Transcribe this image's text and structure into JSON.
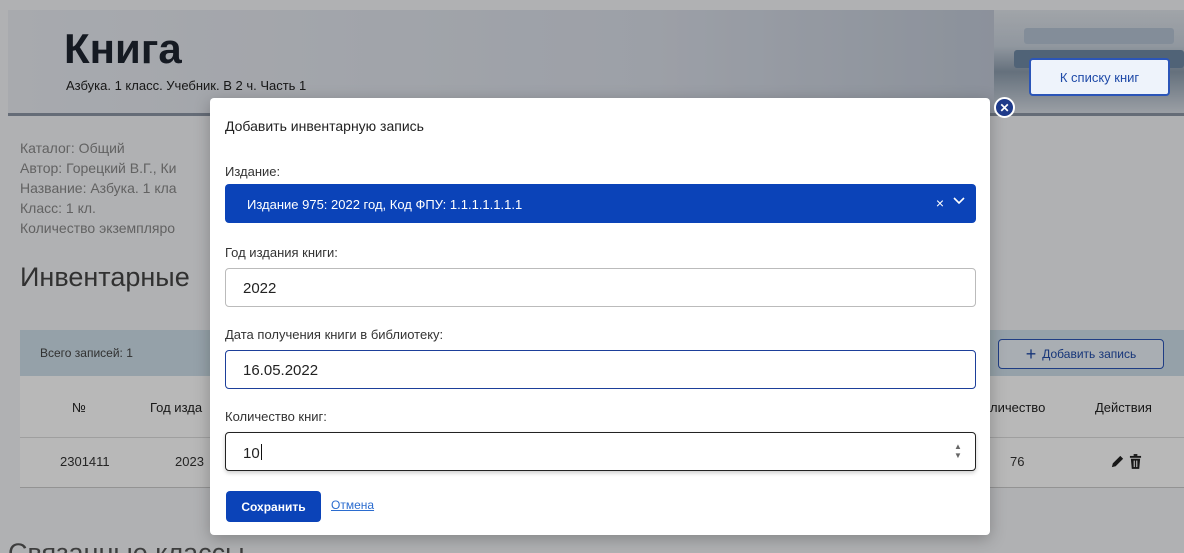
{
  "page": {
    "title": "Книга",
    "subtitle": "Азбука. 1 класс. Учебник. В 2 ч. Часть 1",
    "to_list_button": "К списку книг",
    "info": {
      "catalog": "Каталог: Общий",
      "author": "Автор: Горецкий В.Г., Ки",
      "name": "Название: Азбука. 1 кла",
      "class": "Класс: 1 кл.",
      "count": "Количество экземпляро"
    },
    "inventory_title": "Инвентарные",
    "related_title": "Связанные классы",
    "table": {
      "total": "Всего записей: 1",
      "add_button": "Добавить запись",
      "headers": {
        "num": "№",
        "year": "Год изда",
        "qty": "личество",
        "actions": "Действия"
      },
      "rows": [
        {
          "num": "2301411",
          "year": "2023",
          "qty": "76"
        }
      ]
    }
  },
  "modal": {
    "title": "Добавить инвентарную запись",
    "edition_label": "Издание:",
    "edition_value": "Издание 975: 2022 год, Код ФПУ: 1.1.1.1.1.1.1",
    "year_label": "Год издания книги:",
    "year_value": "2022",
    "date_label": "Дата получения книги в библиотеку:",
    "date_value": "16.05.2022",
    "count_label": "Количество книг:",
    "count_value": "10",
    "save_button": "Сохранить",
    "cancel_link": "Отмена"
  },
  "colors": {
    "primary": "#0b43b8",
    "accent_border": "#2b55b8",
    "link": "#2b6ccf"
  }
}
